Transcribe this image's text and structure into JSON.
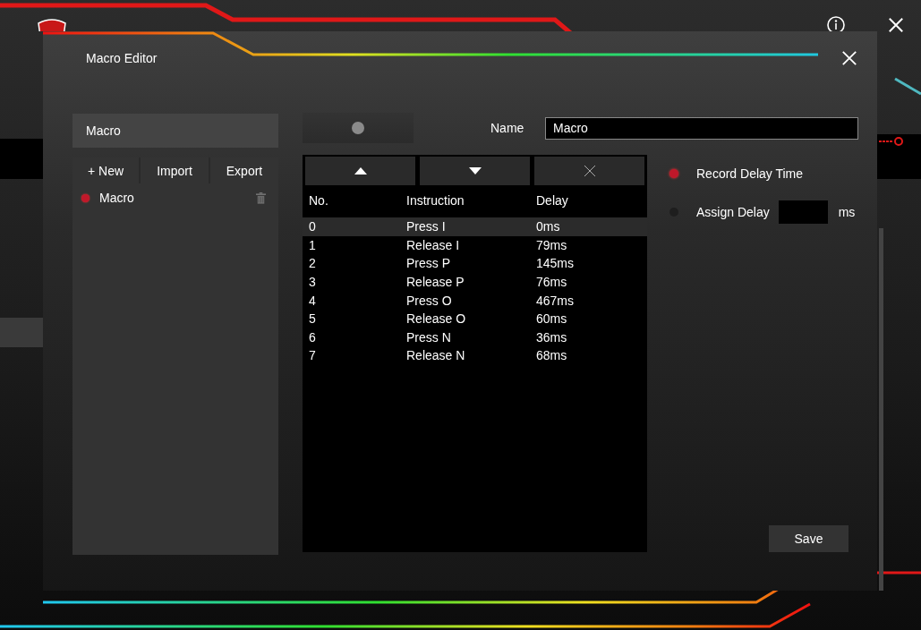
{
  "window": {
    "title": "Macro Editor"
  },
  "macro_list": {
    "header": "Macro",
    "buttons": [
      "+ New",
      "Import",
      "Export"
    ],
    "items": [
      {
        "label": "Macro",
        "selected": true
      }
    ]
  },
  "slider": {
    "level": 0.5
  },
  "name_field": {
    "label": "Name",
    "value": "Macro"
  },
  "table": {
    "columns": [
      "No.",
      "Instruction",
      "Delay"
    ],
    "rows": [
      {
        "cells": [
          "0",
          "Press I",
          "0ms"
        ],
        "selected": true
      },
      {
        "cells": [
          "1",
          "Release I",
          "79ms"
        ],
        "selected": false
      },
      {
        "cells": [
          "2",
          "Press P",
          "145ms"
        ],
        "selected": false
      },
      {
        "cells": [
          "3",
          "Release P",
          "76ms"
        ],
        "selected": false
      },
      {
        "cells": [
          "4",
          "Press O",
          "467ms"
        ],
        "selected": false
      },
      {
        "cells": [
          "5",
          "Release O",
          "60ms"
        ],
        "selected": false
      },
      {
        "cells": [
          "6",
          "Press N",
          "36ms"
        ],
        "selected": false
      },
      {
        "cells": [
          "7",
          "Release N",
          "68ms"
        ],
        "selected": false
      }
    ]
  },
  "delay_options": [
    {
      "kind": "plain",
      "label": "Record Delay Time",
      "selected": true
    },
    {
      "kind": "input",
      "label": "Assign Delay",
      "unit": "ms",
      "selected": false
    }
  ],
  "save_button": "Save"
}
